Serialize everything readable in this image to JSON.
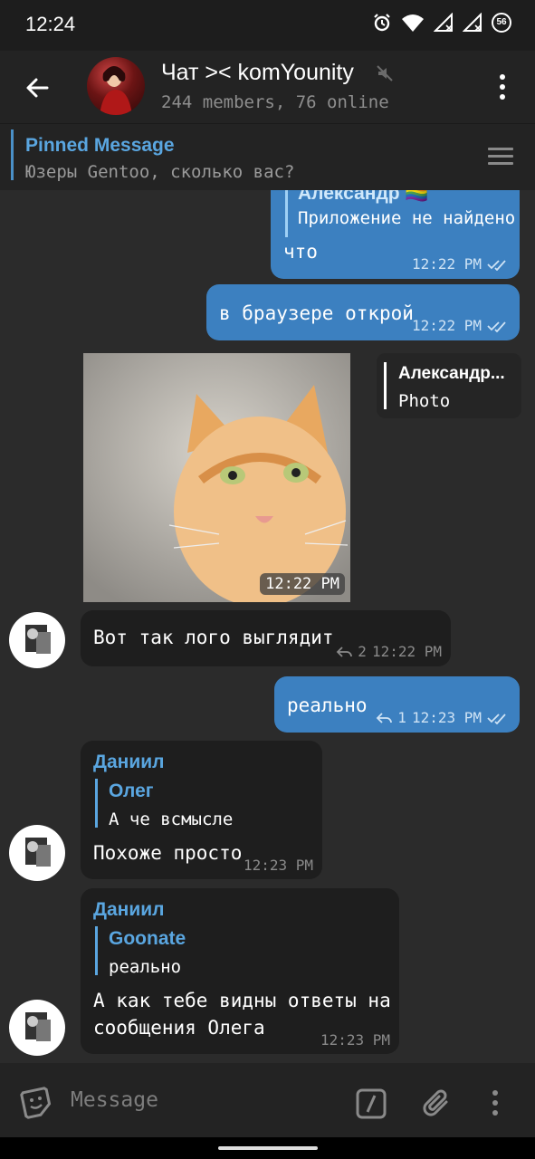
{
  "status_bar": {
    "time": "12:24",
    "battery": "56"
  },
  "header": {
    "title": "Чат >< komYounity",
    "subtitle": "244 members, 76 online"
  },
  "pinned": {
    "title": "Pinned Message",
    "text": "Юзеры Gentoo, сколько вас?"
  },
  "messages": [
    {
      "type": "outgoing",
      "reply_name": "Александр 🏳️‍🌈",
      "reply_text": "Приложение не найдено",
      "text": "что",
      "time": "12:22 PM",
      "status": "read"
    },
    {
      "type": "outgoing",
      "text": "в браузере открой",
      "time": "12:22 PM",
      "status": "read"
    },
    {
      "type": "photo",
      "time": "12:22 PM",
      "reply_card_name": "Александр...",
      "reply_card_text": "Photo"
    },
    {
      "type": "incoming",
      "text": "Вот так лого выглядит",
      "replies": "2",
      "time": "12:22 PM"
    },
    {
      "type": "outgoing",
      "text": "реально",
      "replies": "1",
      "time": "12:23 PM",
      "status": "read"
    },
    {
      "type": "incoming",
      "sender": "Даниил",
      "reply_name": "Олег",
      "reply_text": "А че всмысле",
      "text": "Похоже просто",
      "time": "12:23 PM"
    },
    {
      "type": "incoming",
      "sender": "Даниил",
      "reply_name": "Goonate",
      "reply_text": "реально",
      "text_line1": "А как тебе видны ответы на",
      "text_line2": "сообщения Олега",
      "time": "12:23 PM"
    }
  ],
  "composer": {
    "placeholder": "Message"
  },
  "colors": {
    "accent": "#5aa6e0",
    "outgoing_bubble": "#3c80c0",
    "incoming_bubble": "#1e1e1e",
    "background": "#2b2b2b"
  },
  "icons": [
    "back-arrow-icon",
    "mute-icon",
    "more-vert-icon",
    "list-icon",
    "sticker-icon",
    "command-icon",
    "attach-icon",
    "read-check-icon",
    "reply-icon"
  ]
}
